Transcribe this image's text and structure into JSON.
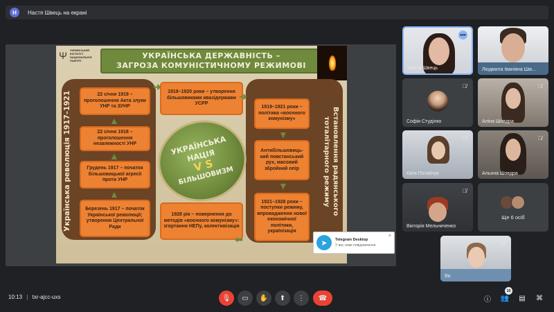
{
  "presenter": {
    "initial": "Н",
    "label": "Настя Швець на екрані"
  },
  "slide": {
    "institute": [
      "УКРАЇНСЬКИЙ",
      "ІНСТИТУТ",
      "НАЦІОНАЛЬНОЇ",
      "ПАМ'ЯТІ"
    ],
    "title_line1": "УКРАЇНСЬКА ДЕРЖАВНІСТЬ –",
    "title_line2": "ЗАГРОЗА КОМУНІСТИЧНОМУ РЕЖИМОВІ",
    "left_side": "Українська революція 1917–1921",
    "right_side": "Встановлення радянського тоталітарного режиму",
    "left_boxes": [
      "22 січня 1919 – проголошення Акта злуки УНР та ЗУНР",
      "22 січня 1918 – проголошення незалежності УНР",
      "Грудень 1917 – початок більшовицької агресії проти УНР",
      "Березень 1917 – початок Української революції; утворення Центральної Ради"
    ],
    "center_top": "1919–1920 роки – утворення більшовиками квазідержави УСРР",
    "center_bottom": "1928 рік – повернення до методів «воєнного комунізму»: згортання НЕПу, колективізація",
    "right_boxes": [
      "1919–1921 роки – політика «воєнного комунізму»",
      "Антибільшовиць-кий повстанський рух, масовий збройний опір",
      "1921–1928 роки – поступки режиму, впровадження нової економічної політики, українізація"
    ],
    "circle": {
      "line1": "УКРАЇНСЬКА",
      "line2": "НАЦІЯ",
      "line3": "V S",
      "line4": "БІЛЬШОВИЗМ"
    }
  },
  "toast": {
    "title": "Telegram Desktop",
    "subtitle": "У вас нове повідомлення",
    "close": "×"
  },
  "participants": [
    {
      "name": "Настя Швець",
      "active": true
    },
    {
      "name": "Людмила Іванівна Шм..."
    },
    {
      "name": "Софія Студілко"
    },
    {
      "name": "Аліна Шовдра"
    },
    {
      "name": "Катя Потайчук"
    },
    {
      "name": "Альона Шовдра"
    },
    {
      "name": "Вікторія Мельниченко"
    },
    {
      "name": "Ви"
    }
  ],
  "more_people": "Ще 6 осіб",
  "meeting": {
    "time": "10:13",
    "separator": "|",
    "code": "txr-ajcc-uxs"
  },
  "people_count": "15",
  "colors": {
    "accent": "#8ab4f8",
    "danger": "#ea4335",
    "background": "#202124"
  }
}
